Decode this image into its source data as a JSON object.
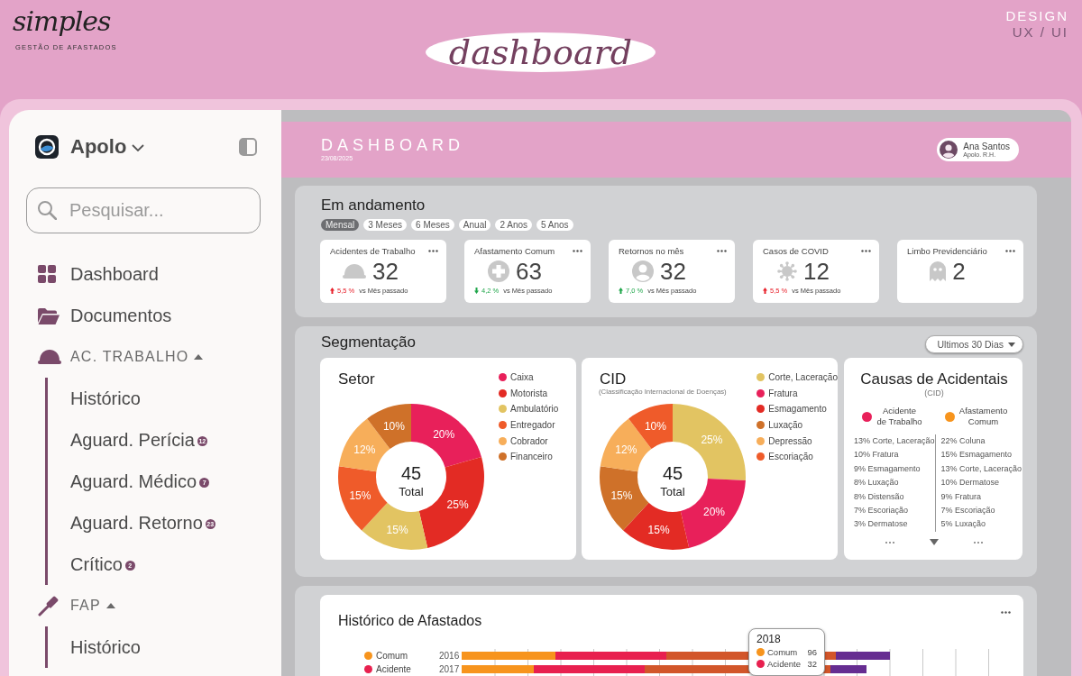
{
  "header": {
    "logo": {
      "wordmark": "simples",
      "tagline": "GESTÃO DE AFASTADOS"
    },
    "title": "dashboard",
    "caption": {
      "line_1": "DESIGN",
      "line_2": "UX / UI"
    }
  },
  "sidebar": {
    "workspace": "Apolo",
    "search": {
      "placeholder": "Pesquisar..."
    },
    "items": [
      {
        "label": "Dashboard"
      },
      {
        "label": "Documentos"
      }
    ],
    "sections": [
      {
        "label": "AC. TRABALHO",
        "expanded": true,
        "children": [
          {
            "label": "Histórico"
          },
          {
            "label": "Aguard. Perícia",
            "badge": "12"
          },
          {
            "label": "Aguard. Médico",
            "badge": "7"
          },
          {
            "label": "Aguard. Retorno",
            "badge": "23"
          },
          {
            "label": "Crítico",
            "badge": "2"
          }
        ]
      },
      {
        "label": "FAP",
        "expanded": true,
        "children": [
          {
            "label": "Histórico"
          }
        ]
      }
    ]
  },
  "page_header": {
    "title": "DASHBOARD",
    "date": "23/08/2025",
    "user": {
      "name": "Ana Santos",
      "role": "Apolo. R.H."
    }
  },
  "in_progress": {
    "title": "Em andamento",
    "periods": [
      {
        "label": "Mensal",
        "selected": true
      },
      {
        "label": "3 Meses",
        "selected": false
      },
      {
        "label": "6 Meses",
        "selected": false
      },
      {
        "label": "Anual",
        "selected": false
      },
      {
        "label": "2 Anos",
        "selected": false
      },
      {
        "label": "5 Anos",
        "selected": false
      }
    ],
    "cards": [
      {
        "title": "Acidentes de Trabalho",
        "value": "32",
        "trend": {
          "up": true,
          "good": false,
          "change": "5,5 %",
          "text": "vs Mês passado"
        }
      },
      {
        "title": "Afastamento Comum",
        "value": "63",
        "trend": {
          "up": false,
          "good": true,
          "change": "4,2 %",
          "text": "vs Mês passado"
        }
      },
      {
        "title": "Retornos no mês",
        "value": "32",
        "trend": {
          "up": true,
          "good": true,
          "change": "7,0 %",
          "text": "vs Mês passado"
        }
      },
      {
        "title": "Casos de COVID",
        "value": "12",
        "trend": {
          "up": true,
          "good": false,
          "change": "5,5 %",
          "text": "vs Mês passado"
        }
      },
      {
        "title": "Limbo Previdenciário",
        "value": "2"
      }
    ]
  },
  "segmentation": {
    "title": "Segmentação",
    "range": "Ultimos 30 Dias",
    "sector": {
      "total": "45",
      "total_label": "Total",
      "chart_data": {
        "type": "donut",
        "title": "Setor",
        "categories": [
          "Caixa",
          "Motorista",
          "Ambulatório",
          "Entregador",
          "Cobrador",
          "Financeiro"
        ],
        "values": [
          20,
          25,
          15,
          15,
          12,
          10
        ],
        "colors": [
          "#e8205a",
          "#e32b24",
          "#e2c462",
          "#ef5b2a",
          "#f7ae5a",
          "#cf7129"
        ],
        "value_labels": [
          "20%",
          "25%",
          "15%",
          "15%",
          "12%",
          "10%"
        ]
      }
    },
    "cid": {
      "subtitle": "(Classificação Internacional de Doenças)",
      "total": "45",
      "total_label": "Total",
      "chart_data": {
        "type": "donut",
        "title": "CID",
        "categories": [
          "Corte, Laceração",
          "Fratura",
          "Esmagamento",
          "Luxação",
          "Depressão",
          "Escoriação"
        ],
        "values": [
          25,
          20,
          15,
          15,
          12,
          10
        ],
        "colors": [
          "#e2c462",
          "#e8205a",
          "#e32b24",
          "#cf7129",
          "#f7ae5a",
          "#ef5b2a"
        ],
        "value_labels": [
          "25%",
          "20%",
          "15%",
          "15%",
          "12%",
          "10%"
        ]
      }
    },
    "causes": {
      "title": "Causas de Acidentais",
      "subtitle": "(CID)",
      "columns": [
        {
          "label": "Acidente\nde Trabalho",
          "color": "#e8205a",
          "items": [
            "13% Corte, Laceração",
            "10% Fratura",
            "9% Esmagamento",
            "8% Luxação",
            "8% Distensão",
            "7% Escoriação",
            "3% Dermatose"
          ]
        },
        {
          "label": "Afastamento\nComum",
          "color": "#f7941d",
          "items": [
            "22% Coluna",
            "15% Esmagamento",
            "13% Corte, Laceração",
            "10% Dermatose",
            "9% Fratura",
            "7% Escoriação",
            "5% Luxação"
          ]
        }
      ]
    }
  },
  "history": {
    "title": "Histórico de Afastados",
    "legend": [
      {
        "label": "Comum",
        "color": "#f7941d"
      },
      {
        "label": "Acidente",
        "color": "#e8204f"
      }
    ],
    "years": [
      "2016",
      "2017"
    ],
    "tooltip": {
      "title": "2018",
      "rows": [
        {
          "label": "Comum",
          "value": "96",
          "color": "#f7941d"
        },
        {
          "label": "Acidente",
          "value": "32",
          "color": "#e8204f"
        }
      ]
    }
  }
}
